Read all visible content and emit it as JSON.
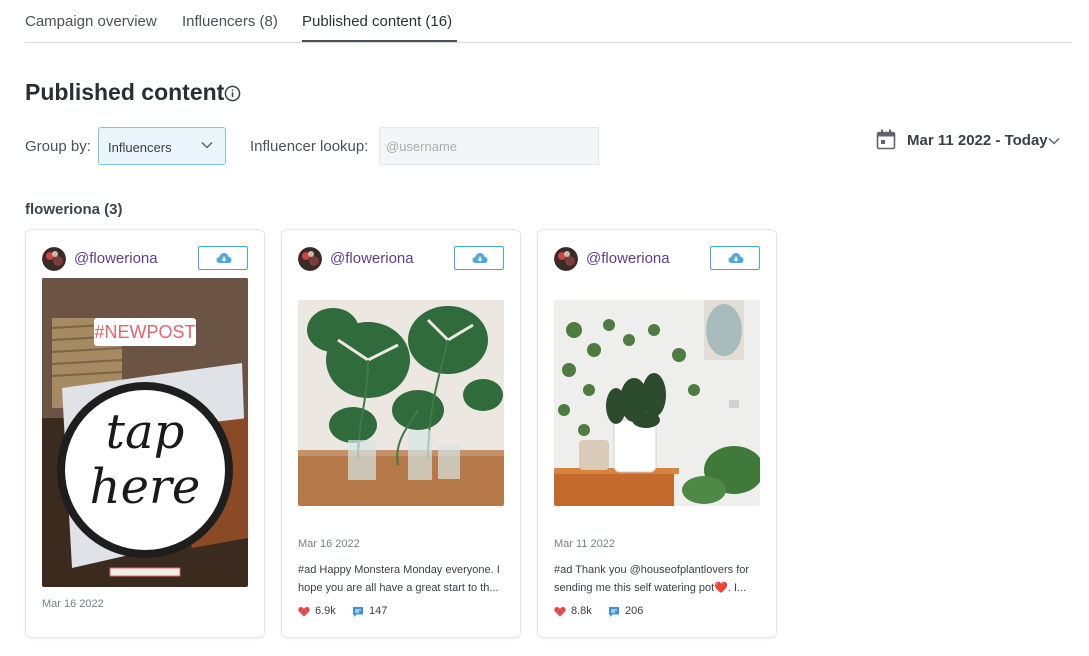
{
  "tabs": [
    {
      "label": "Campaign overview",
      "active": false
    },
    {
      "label": "Influencers (8)",
      "active": false
    },
    {
      "label": "Published content (16)",
      "active": true
    }
  ],
  "page": {
    "title": "Published content",
    "info_icon": "info-circle-icon"
  },
  "filters": {
    "group_by_label": "Group by:",
    "group_by_value": "Influencers",
    "lookup_label": "Influencer lookup:",
    "lookup_placeholder": "@username",
    "lookup_value": "",
    "date_range": "Mar 11 2022 - Today",
    "calendar_icon": "calendar-icon"
  },
  "group": {
    "heading": "floweriona (3)"
  },
  "cards": [
    {
      "handle": "@floweriona",
      "type": "story",
      "story_tag": "#NEWPOST",
      "story_text_1": "tap",
      "story_text_2": "here",
      "date": "Mar 16 2022",
      "download_icon": "cloud-download-icon"
    },
    {
      "handle": "@floweriona",
      "type": "post",
      "date": "Mar 16 2022",
      "caption_line_1": "#ad Happy Monstera Monday everyone. I",
      "caption_line_2": "hope you are all have a great start to th...",
      "likes": "6.9k",
      "comments": "147",
      "download_icon": "cloud-download-icon"
    },
    {
      "handle": "@floweriona",
      "type": "post",
      "date": "Mar 11 2022",
      "caption_line_1": "#ad Thank you @houseofplantlovers for",
      "caption_line_2": "sending me this self watering pot❤️. I...",
      "likes": "8.8k",
      "comments": "206",
      "download_icon": "cloud-download-icon"
    }
  ],
  "colors": {
    "accent": "#4ba7dd",
    "handle": "#5d3f8e",
    "like": "#e5484d",
    "comment": "#3d8fd6"
  }
}
